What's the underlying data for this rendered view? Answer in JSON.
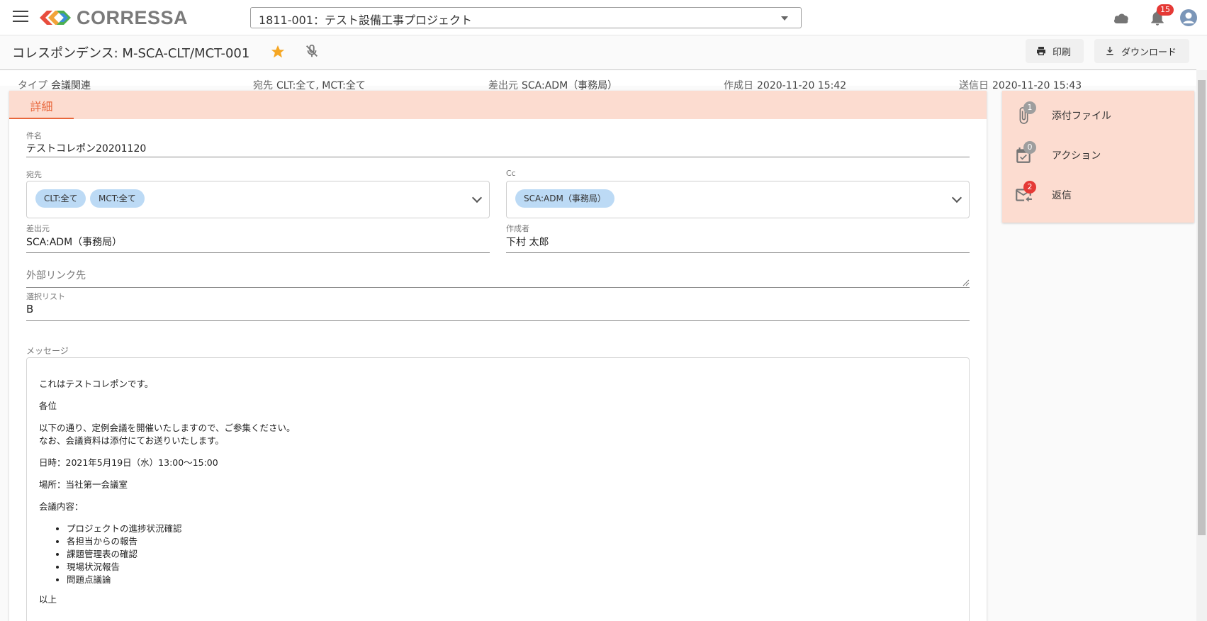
{
  "app": {
    "logo_text": "CORRESSA",
    "project": "1811-001：テスト設備工事プロジェクト",
    "notification_count": "15"
  },
  "header": {
    "title": "コレスポンデンス: M-SCA-CLT/MCT-001",
    "print_label": "印刷",
    "download_label": "ダウンロード"
  },
  "info": {
    "type_label": "タイプ",
    "type_value": "会議関連",
    "to_label": "宛先",
    "to_value": "CLT:全て, MCT:全て",
    "from_label": "差出元",
    "from_value": "SCA:ADM（事務局）",
    "created_label": "作成日",
    "created_value": "2020-11-20 15:42",
    "sent_label": "送信日",
    "sent_value": "2020-11-20 15:43"
  },
  "tab": {
    "label": "詳細"
  },
  "form": {
    "subject_label": "件名",
    "subject_value": "テストコレポン20201120",
    "to_label": "宛先",
    "to_chips": [
      "CLT:全て",
      "MCT:全て"
    ],
    "cc_label": "Cc",
    "cc_chips": [
      "SCA:ADM（事務局）"
    ],
    "sender_label": "差出元",
    "sender_value": "SCA:ADM（事務局）",
    "author_label": "作成者",
    "author_value": "下村 太郎",
    "external_link_placeholder": "外部リンク先",
    "select_label": "選択リスト",
    "select_value": "B",
    "message_label": "メッセージ"
  },
  "message": {
    "line1": "これはテストコレポンです。",
    "line2": "各位",
    "line3": "以下の通り、定例会議を開催いたしますので、ご参集ください。",
    "line4": "なお、会議資料は添付にてお送りいたします。",
    "line5": "日時：2021年5月19日（水）13:00～15:00",
    "line6": "場所：当社第一会議室",
    "line7": "会議内容：",
    "items": [
      "プロジェクトの進捗状況確認",
      "各担当からの報告",
      "課題管理表の確認",
      "現場状況報告",
      "問題点議論"
    ],
    "closing": "以上"
  },
  "side_panel": {
    "attachments_label": "添付ファイル",
    "attachments_count": "1",
    "actions_label": "アクション",
    "actions_count": "0",
    "replies_label": "返信",
    "replies_count": "2"
  },
  "colors": {
    "accent": "#e8673c",
    "tab_bg": "#fcdcd0",
    "chip_bg": "#bcdaf5",
    "badge_red": "#e53935",
    "star": "#f5a623"
  }
}
